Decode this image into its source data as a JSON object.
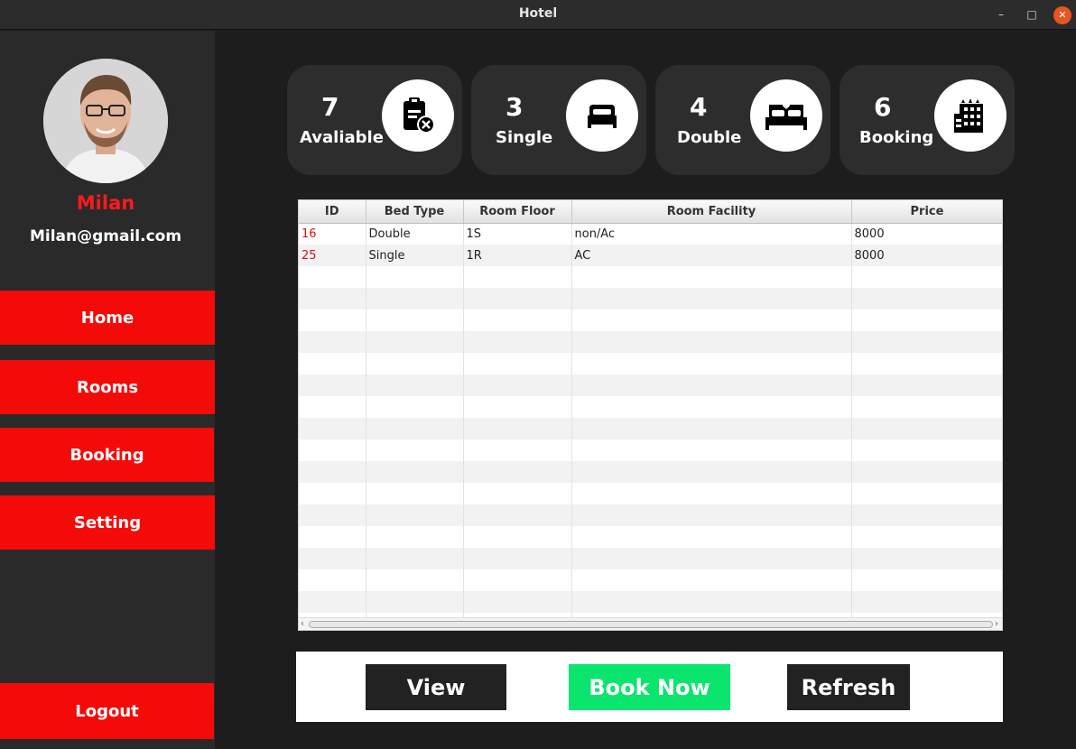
{
  "window": {
    "title": "Hotel",
    "minimize": "–",
    "maximize": "□",
    "close": "✕"
  },
  "profile": {
    "name": "Milan",
    "email": "Milan@gmail.com"
  },
  "nav": {
    "home": "Home",
    "rooms": "Rooms",
    "booking": "Booking",
    "setting": "Setting",
    "logout": "Logout"
  },
  "stats": [
    {
      "value": "7",
      "label": "Avaliable",
      "icon": "clipboard-remove-icon"
    },
    {
      "value": "3",
      "label": "Single",
      "icon": "single-bed-icon"
    },
    {
      "value": "4",
      "label": "Double",
      "icon": "double-bed-icon"
    },
    {
      "value": "6",
      "label": "Booking",
      "icon": "hotel-building-icon"
    }
  ],
  "table": {
    "columns": [
      "ID",
      "Bed Type",
      "Room Floor",
      "Room Facility",
      "Price"
    ],
    "rows": [
      [
        "16",
        "Double",
        "1S",
        "non/Ac",
        "8000"
      ],
      [
        "25",
        "Single",
        "1R",
        "AC",
        "8000"
      ]
    ],
    "scroll_left": "‹",
    "scroll_right": "›"
  },
  "actions": {
    "view": "View",
    "book_now": "Book Now",
    "refresh": "Refresh"
  },
  "colors": {
    "accent_red": "#f50a0a",
    "book_green": "#0be56e",
    "sidebar": "#2a2a2a",
    "card": "#2d2d2d"
  }
}
